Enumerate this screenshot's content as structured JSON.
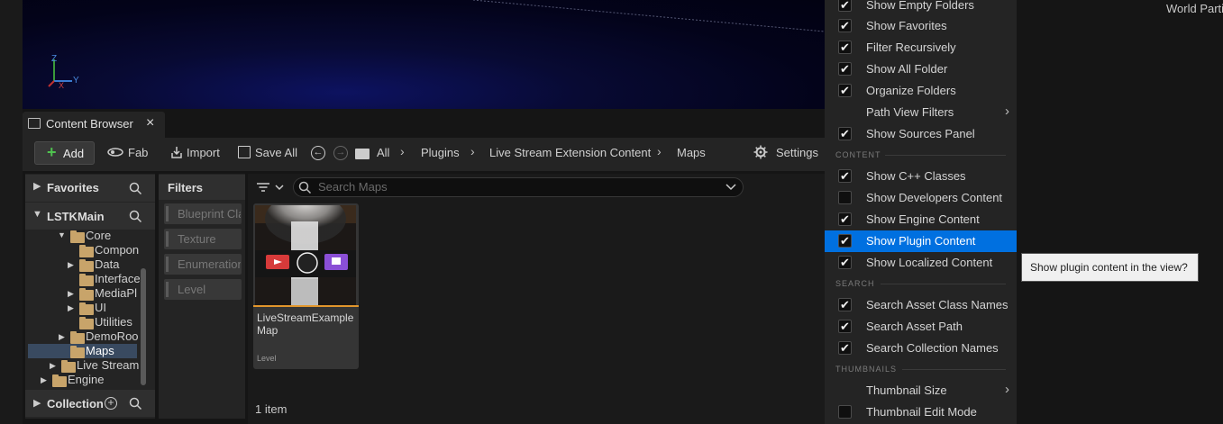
{
  "viewport": {
    "axis_x": "X",
    "axis_y": "Y",
    "axis_z": "Z"
  },
  "world_partition": "World Parti",
  "content_browser": {
    "tab_title": "Content Browser",
    "close_glyph": "×",
    "toolbar": {
      "add": "Add",
      "fab": "Fab",
      "import": "Import",
      "save_all": "Save All",
      "settings": "Settings"
    },
    "breadcrumb": [
      "All",
      "Plugins",
      "Live Stream Extension Content",
      "Maps"
    ],
    "tree": {
      "favorites": "Favorites",
      "root": "LSTKMain",
      "items": [
        "Core",
        "Compon",
        "Data",
        "Interface",
        "MediaPl",
        "UI",
        "Utilities",
        "DemoRoo",
        "Maps",
        "Live Stream",
        "Engine"
      ],
      "collections": "Collection"
    },
    "filters": {
      "title": "Filters",
      "items": [
        "Blueprint Cla",
        "Texture",
        "Enumeration",
        "Level"
      ]
    },
    "search_placeholder": "Search Maps",
    "asset": {
      "name_line1": "LiveStreamExample",
      "name_line2": "Map",
      "type": "Level"
    },
    "item_count": "1 item"
  },
  "menu": {
    "items": [
      {
        "label": "Show Empty Folders",
        "checked": true
      },
      {
        "label": "Show Favorites",
        "checked": true
      },
      {
        "label": "Filter Recursively",
        "checked": true
      },
      {
        "label": "Show All Folder",
        "checked": true
      },
      {
        "label": "Organize Folders",
        "checked": true
      },
      {
        "label": "Path View Filters",
        "submenu": true
      },
      {
        "label": "Show Sources Panel",
        "checked": true
      },
      {
        "section": "CONTENT"
      },
      {
        "label": "Show C++ Classes",
        "checked": true
      },
      {
        "label": "Show Developers Content",
        "checked": false
      },
      {
        "label": "Show Engine Content",
        "checked": true
      },
      {
        "label": "Show Plugin Content",
        "checked": true,
        "selected": true
      },
      {
        "label": "Show Localized Content",
        "checked": true
      },
      {
        "section": "SEARCH"
      },
      {
        "label": "Search Asset Class Names",
        "checked": true
      },
      {
        "label": "Search Asset Path",
        "checked": true
      },
      {
        "label": "Search Collection Names",
        "checked": true
      },
      {
        "section": "THUMBNAILS"
      },
      {
        "label": "Thumbnail Size",
        "submenu": true
      },
      {
        "label": "Thumbnail Edit Mode",
        "checked": false
      }
    ]
  },
  "tooltip": "Show plugin content in the view?",
  "colors": {
    "selection": "#0070e0",
    "asset_underline": "#e2962c",
    "folder": "#c8a46a"
  }
}
